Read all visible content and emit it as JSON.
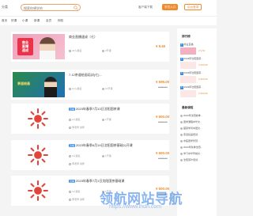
{
  "header": {
    "logo_text": "分类",
    "search_placeholder": "搜索你想学的",
    "cart_label": "客户端下载",
    "login_label": "学员入口",
    "register_label": "后台登录"
  },
  "nav": [
    "首页",
    "好课",
    "小课",
    "新课",
    "会员",
    "网校"
  ],
  "courses": [
    {
      "title": "商业直播速成（七）",
      "tag": "",
      "students": "44人报名",
      "lessons": "3节课",
      "price": "¥ 9.60",
      "old_price": "",
      "thumb_text": [
        "商业",
        "直播",
        "速成"
      ]
    },
    {
      "title": "7.12茶道绘画培训(七)...",
      "tag": "",
      "students": "14人报名",
      "lessons": "12节课",
      "price": "¥ 699.00",
      "old_price": "¥1000.00",
      "thumb_text": [
        "茶道绘画"
      ]
    },
    {
      "title": "2023年春季7月13日沈阳国茶课",
      "tag": "直播",
      "students": "3人报名",
      "lessons": "1节课",
      "price": "¥ 600.00",
      "old_price": "¥1000.00",
      "teacher": "李老师 讲师"
    },
    {
      "title": "2023年春季6月19日沈阳国茶基础公开课",
      "tag": "直播",
      "students": "3人报名",
      "lessons": "1节课",
      "price": "¥ 600.00",
      "old_price": "¥1000.00",
      "teacher": "李老师 讲师"
    },
    {
      "title": "2023年春季7月1日沈阳国茶基础课",
      "tag": "直播",
      "students": "3人报名",
      "lessons": "1节课",
      "price": "¥ 600.00",
      "old_price": "¥1000.00",
      "teacher": "李老师 讲师"
    }
  ],
  "sidebar": {
    "heading": "排行榜",
    "top_items": [
      {
        "title": "商业直播",
        "price": "¥ 9.60"
      },
      {
        "title": "2023年沈阳国茶...",
        "price": "¥ 600.00"
      },
      {
        "title": "2023年沈阳国茶...",
        "price": "¥ 600.00"
      },
      {
        "title": "2023年沈阳国茶...",
        "price": "¥ 600.00"
      }
    ],
    "list_heading": "最新课程",
    "list": [
      "2023年沈阳春季...",
      "国学课程中华文...",
      "藏茶学问中国文...",
      "茶道绘画培训...",
      "中医国学智慧...",
      "2023年秋季沈阳...",
      "学习中华传统文...",
      "沈阳茶叶培训..."
    ]
  },
  "watermark": {
    "text": "领航网站导航",
    "url": "https://www.lhdh.com"
  },
  "colors": {
    "accent": "#f08a2c",
    "blue": "#3a8ee6",
    "sun_red": "#e0443a"
  }
}
